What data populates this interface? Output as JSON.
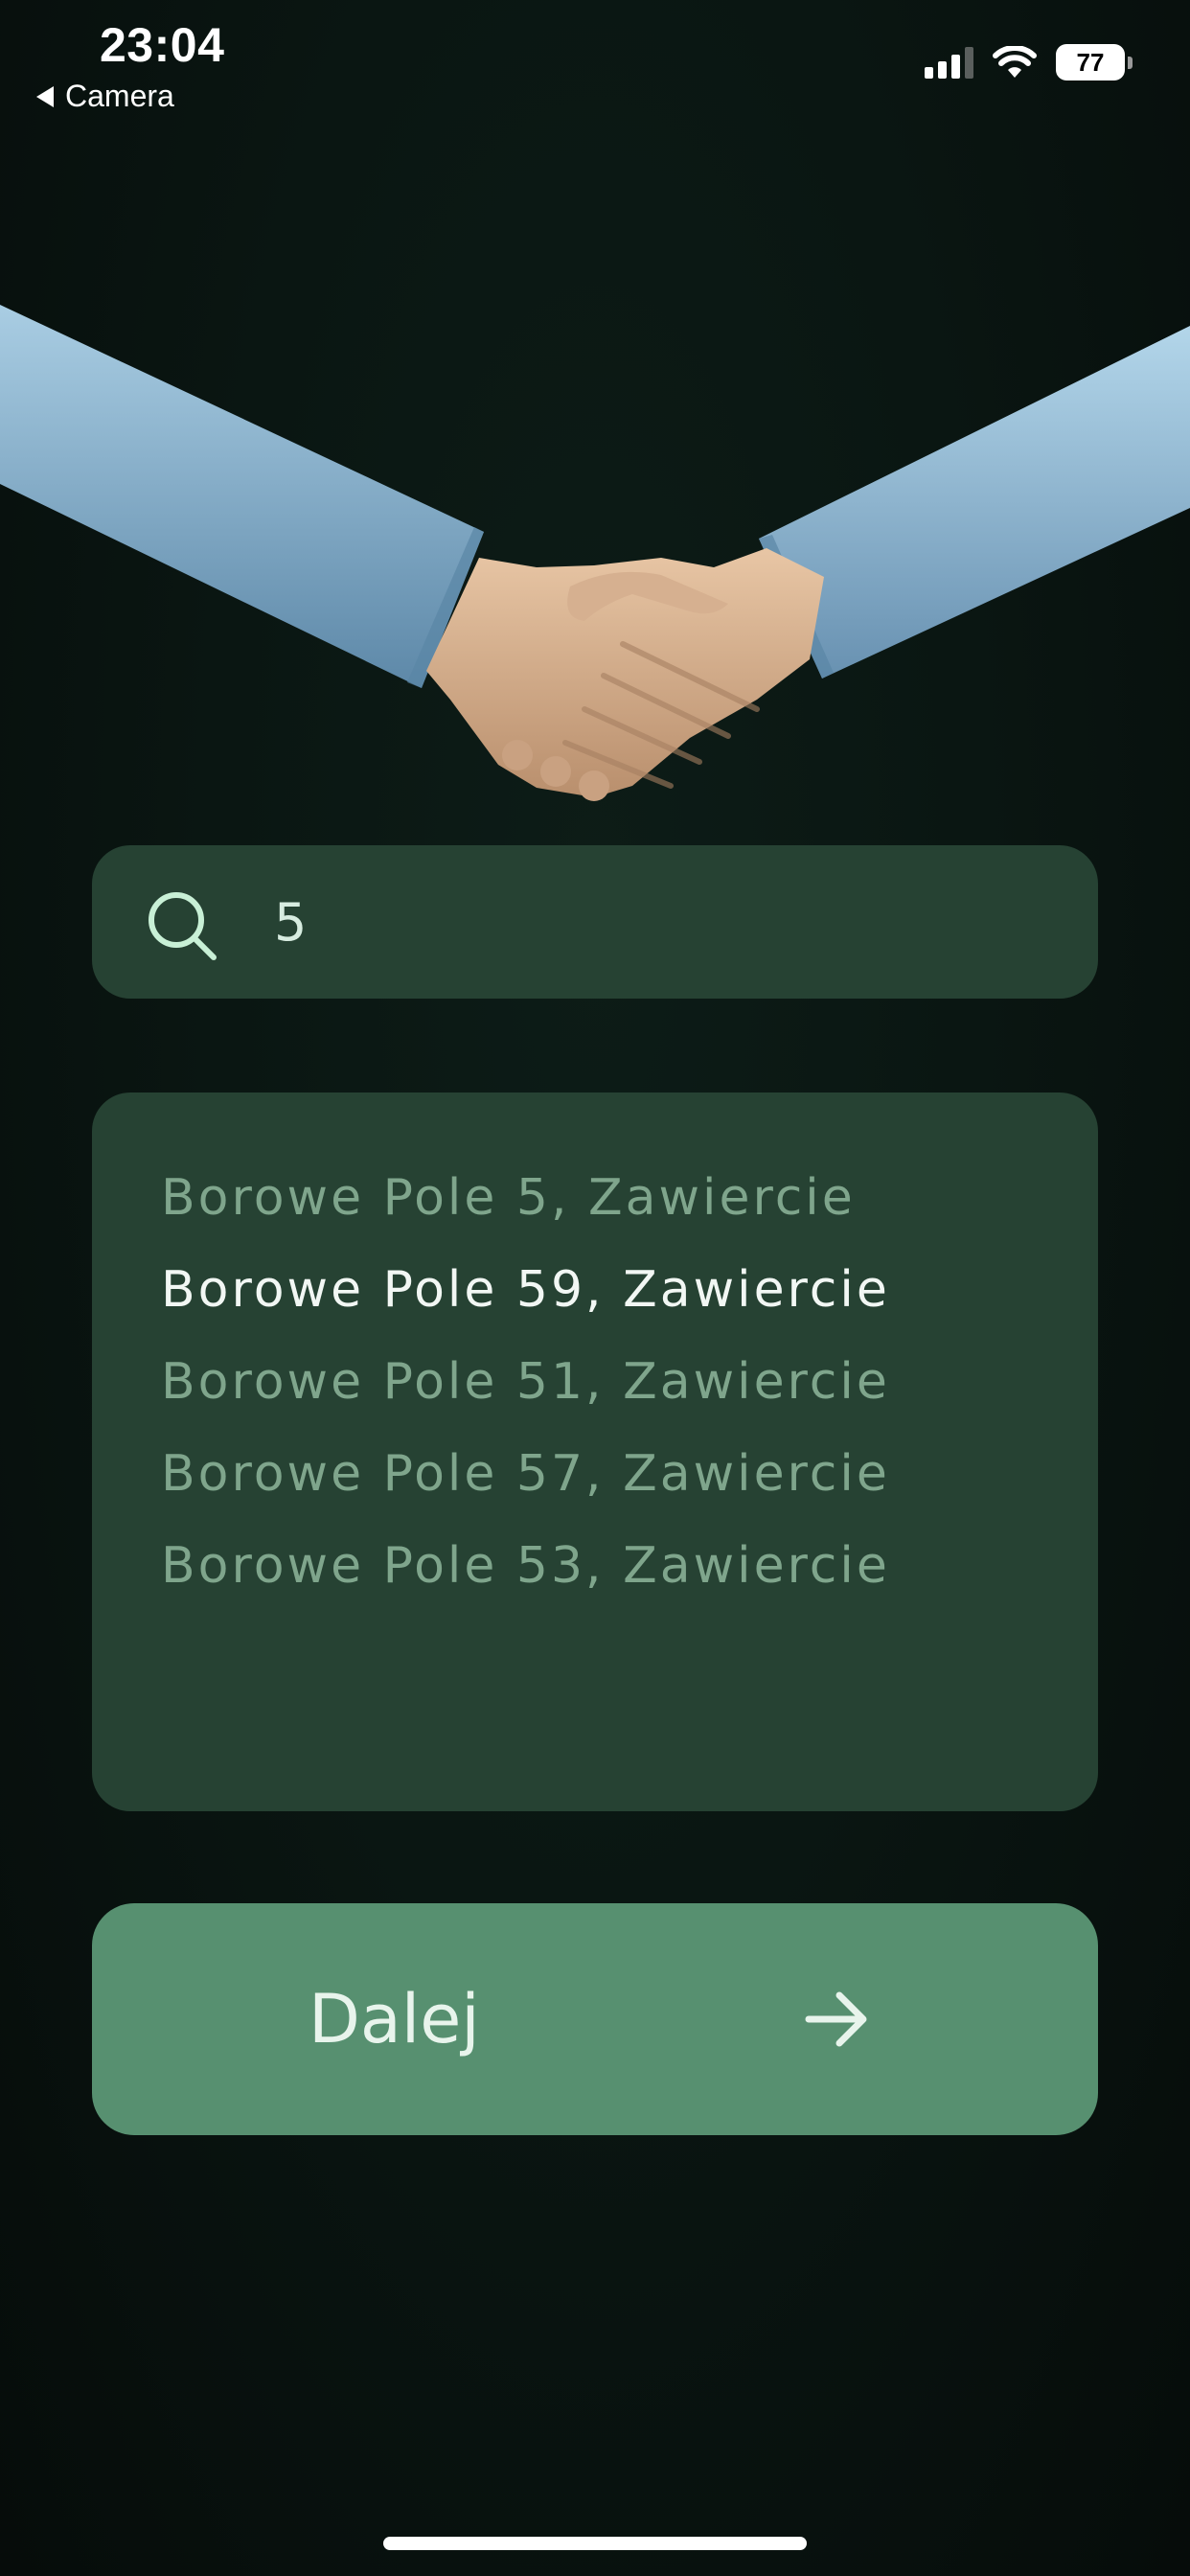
{
  "status_bar": {
    "time": "23:04",
    "back_label": "Camera",
    "battery": "77"
  },
  "search": {
    "value": "5",
    "icon": "search-icon"
  },
  "suggestions": [
    {
      "label": "Borowe Pole 5, Zawiercie"
    },
    {
      "label": "Borowe Pole 59, Zawiercie"
    },
    {
      "label": "Borowe Pole 51, Zawiercie"
    },
    {
      "label": "Borowe Pole 57, Zawiercie"
    },
    {
      "label": "Borowe Pole 53, Zawiercie"
    }
  ],
  "next_button": {
    "label": "Dalej",
    "icon": "arrow-right-icon"
  },
  "colors": {
    "background": "#0a1612",
    "card": "#264233",
    "button": "#579070",
    "suggestion_text": "#7fa58c",
    "suggestion_active_text": "#f2f7f4"
  }
}
